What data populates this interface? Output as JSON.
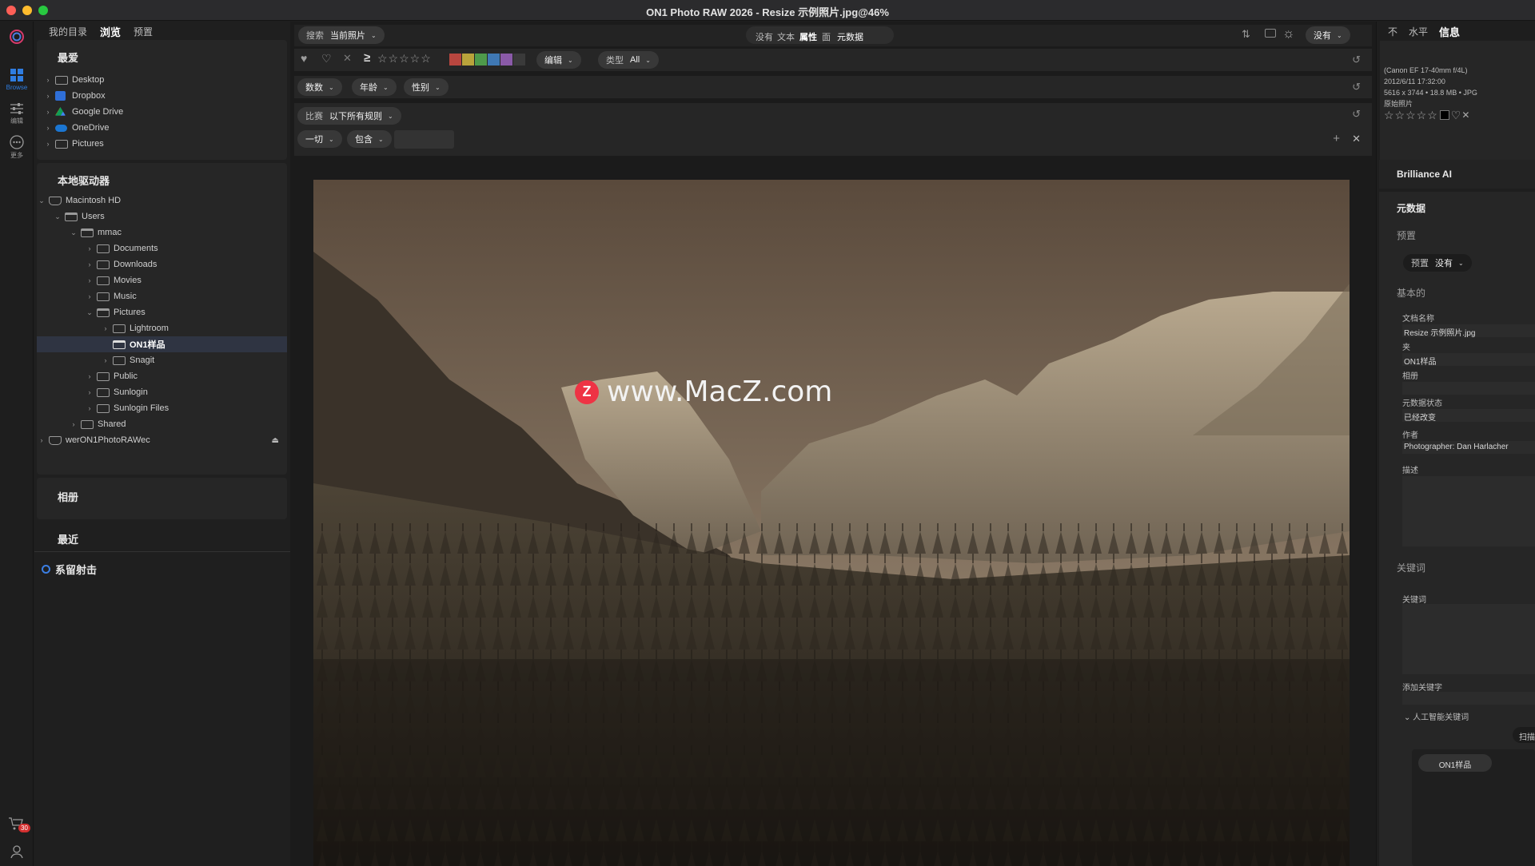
{
  "window": {
    "title": "ON1 Photo RAW 2026 - Resize 示例照片.jpg@46%"
  },
  "rail": {
    "browse_label": "Browse",
    "edit_label": "编辑",
    "more_label": "更多",
    "cart_badge": "30",
    "accent": "#2f7de1"
  },
  "left_tabs": [
    "我的目录",
    "浏览",
    "预置"
  ],
  "favorites": {
    "title": "最爱",
    "items": [
      "Desktop",
      "Dropbox",
      "Google Drive",
      "OneDrive",
      "Pictures"
    ]
  },
  "local_drives": {
    "title": "本地驱动器",
    "tree": [
      {
        "label": "Macintosh HD"
      },
      {
        "label": "Users"
      },
      {
        "label": "mmac"
      },
      {
        "label": "Documents"
      },
      {
        "label": "Downloads"
      },
      {
        "label": "Movies"
      },
      {
        "label": "Music"
      },
      {
        "label": "Pictures"
      },
      {
        "label": "Lightroom"
      },
      {
        "label": "ON1样品"
      },
      {
        "label": "Snagit"
      },
      {
        "label": "Public"
      },
      {
        "label": "Sunlogin"
      },
      {
        "label": "Sunlogin Files"
      },
      {
        "label": "Shared"
      },
      {
        "label": "werON1PhotoRAWec"
      }
    ]
  },
  "albums": {
    "title": "相册"
  },
  "recent": {
    "title": "最近"
  },
  "tether": {
    "title": "系留射击"
  },
  "toolbar": {
    "search_label": "搜索",
    "search_value": "当前照片",
    "segments": [
      "没有",
      "文本",
      "属性",
      "面",
      "元数据"
    ],
    "preset_value": "没有"
  },
  "filters": {
    "edit_label": "编辑",
    "type_label": "类型",
    "type_value": "All",
    "count_label": "数数",
    "age_label": "年龄",
    "gender_label": "性别",
    "match_label": "比赛",
    "match_value": "以下所有规则",
    "all_label": "一切",
    "contains_label": "包含",
    "text_value": "",
    "colors": [
      "#b8463f",
      "#b9a33b",
      "#4e9a4b",
      "#3f78b4",
      "#8a5aa8",
      "#3a3a3a"
    ]
  },
  "watermark": "www.MacZ.com",
  "right_tabs": [
    "不",
    "水平",
    "信息"
  ],
  "info": {
    "lens": "(Canon EF 17-40mm f/4L)",
    "datetime": "2012/6/11  17:32:00",
    "dims": "5616 x 3744 • 18.8 MB • JPG",
    "original": "原始照片"
  },
  "brilliance": "Brilliance AI",
  "metadata": {
    "title": "元数据",
    "preset_heading": "预置",
    "preset_label": "预置",
    "preset_value": "没有",
    "basic": "基本的",
    "fields": [
      {
        "label": "文档名称",
        "value": "Resize 示例照片.jpg"
      },
      {
        "label": "夹",
        "value": "ON1样品"
      },
      {
        "label": "相册",
        "value": ""
      },
      {
        "label": "元数据状态",
        "value": "已经改变"
      },
      {
        "label": "作者",
        "value": "Photographer: Dan Harlacher"
      },
      {
        "label": "描述",
        "value": ""
      }
    ],
    "keywords_heading": "关键词",
    "keywords_label": "关键词",
    "add_keyword_label": "添加关键字",
    "ai_keywords_label": "人工智能关键词",
    "scan_label": "扫描",
    "keyword_chip": "ON1样品"
  }
}
